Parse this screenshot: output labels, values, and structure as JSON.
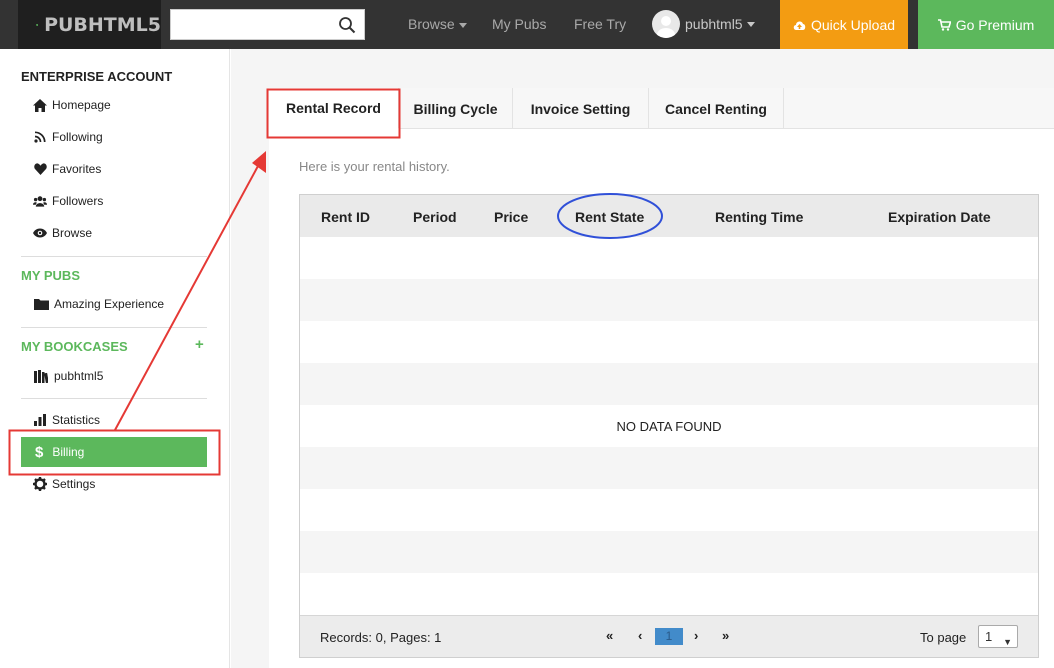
{
  "header": {
    "logo_text": "PUBHTML5",
    "search": {
      "value": "",
      "placeholder": ""
    },
    "nav": {
      "browse": "Browse",
      "my_pubs": "My Pubs",
      "free_try": "Free Try"
    },
    "user_name": "pubhtml5",
    "quick_upload": "Quick Upload",
    "go_premium": "Go Premium",
    "colors": {
      "bar": "#333333",
      "upload": "#f39c12",
      "premium": "#5cb85c"
    }
  },
  "sidebar": {
    "account_heading": "ENTERPRISE ACCOUNT",
    "account_items": [
      {
        "label": "Homepage",
        "icon": "home-icon"
      },
      {
        "label": "Following",
        "icon": "rss-icon"
      },
      {
        "label": "Favorites",
        "icon": "heart-icon"
      },
      {
        "label": "Followers",
        "icon": "users-icon"
      },
      {
        "label": "Browse",
        "icon": "eye-icon"
      }
    ],
    "my_pubs_heading": "MY PUBS",
    "my_pubs_items": [
      {
        "label": "Amazing Experience",
        "icon": "folder-icon"
      }
    ],
    "my_bookcases_heading": "MY BOOKCASES",
    "add_symbol": "+",
    "bookcase_items": [
      {
        "label": "pubhtml5",
        "icon": "books-icon"
      }
    ],
    "tools": {
      "statistics": "Statistics",
      "billing": "Billing",
      "settings": "Settings"
    },
    "active_item": "Billing"
  },
  "main": {
    "tabs": [
      "Rental Record",
      "Billing Cycle",
      "Invoice Setting",
      "Cancel Renting"
    ],
    "active_tab": "Rental Record",
    "subtitle": "Here is your rental history.",
    "table": {
      "columns": [
        "Rent ID",
        "Period",
        "Price",
        "Rent State",
        "Renting Time",
        "Expiration Date"
      ],
      "rows": [],
      "empty_message": "NO DATA FOUND"
    },
    "footer": {
      "records_text": "Records: 0, Pages: 1",
      "first": "«",
      "prev": "‹",
      "current_page": "1",
      "next": "›",
      "last": "»",
      "to_page_label": "To page",
      "to_page_value": "1"
    }
  },
  "annotations": {
    "highlight_box_color": "#e53935",
    "circle_color": "#3050d8",
    "arrow_color": "#e53935"
  }
}
